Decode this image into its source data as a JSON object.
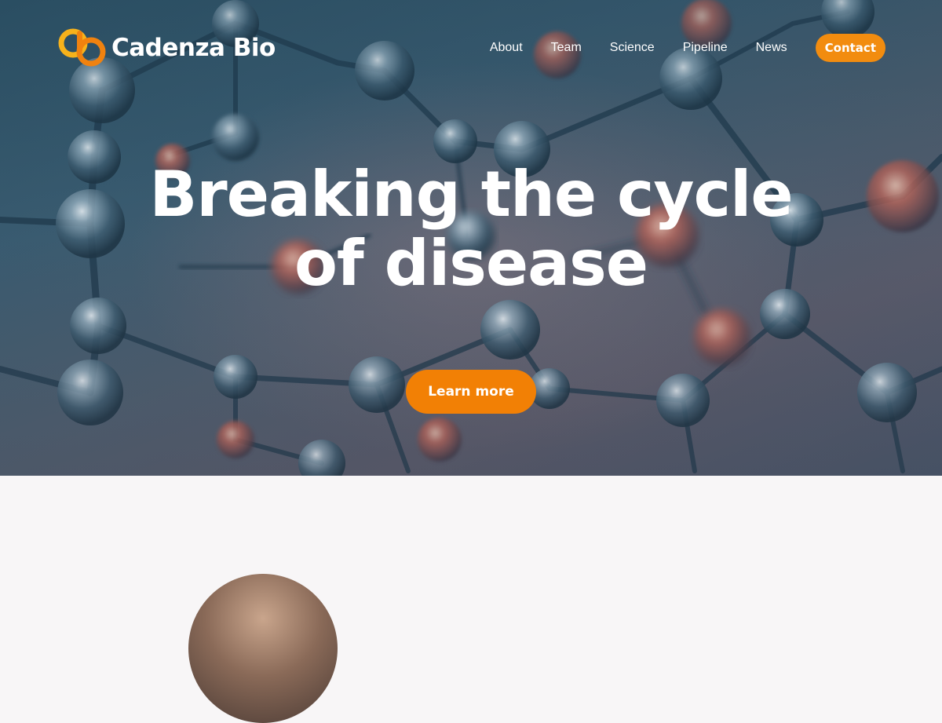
{
  "brand": {
    "name": "Cadenza Bio",
    "colors": {
      "accent": "#f28005",
      "logo_yellow": "#f7b21b",
      "logo_orange": "#f0820f"
    }
  },
  "nav": {
    "links": [
      "About",
      "Team",
      "Science",
      "Pipeline",
      "News"
    ],
    "contact_label": "Contact"
  },
  "hero": {
    "headline_line1": "Breaking the cycle",
    "headline_line2": "of disease",
    "cta_label": "Learn more"
  }
}
